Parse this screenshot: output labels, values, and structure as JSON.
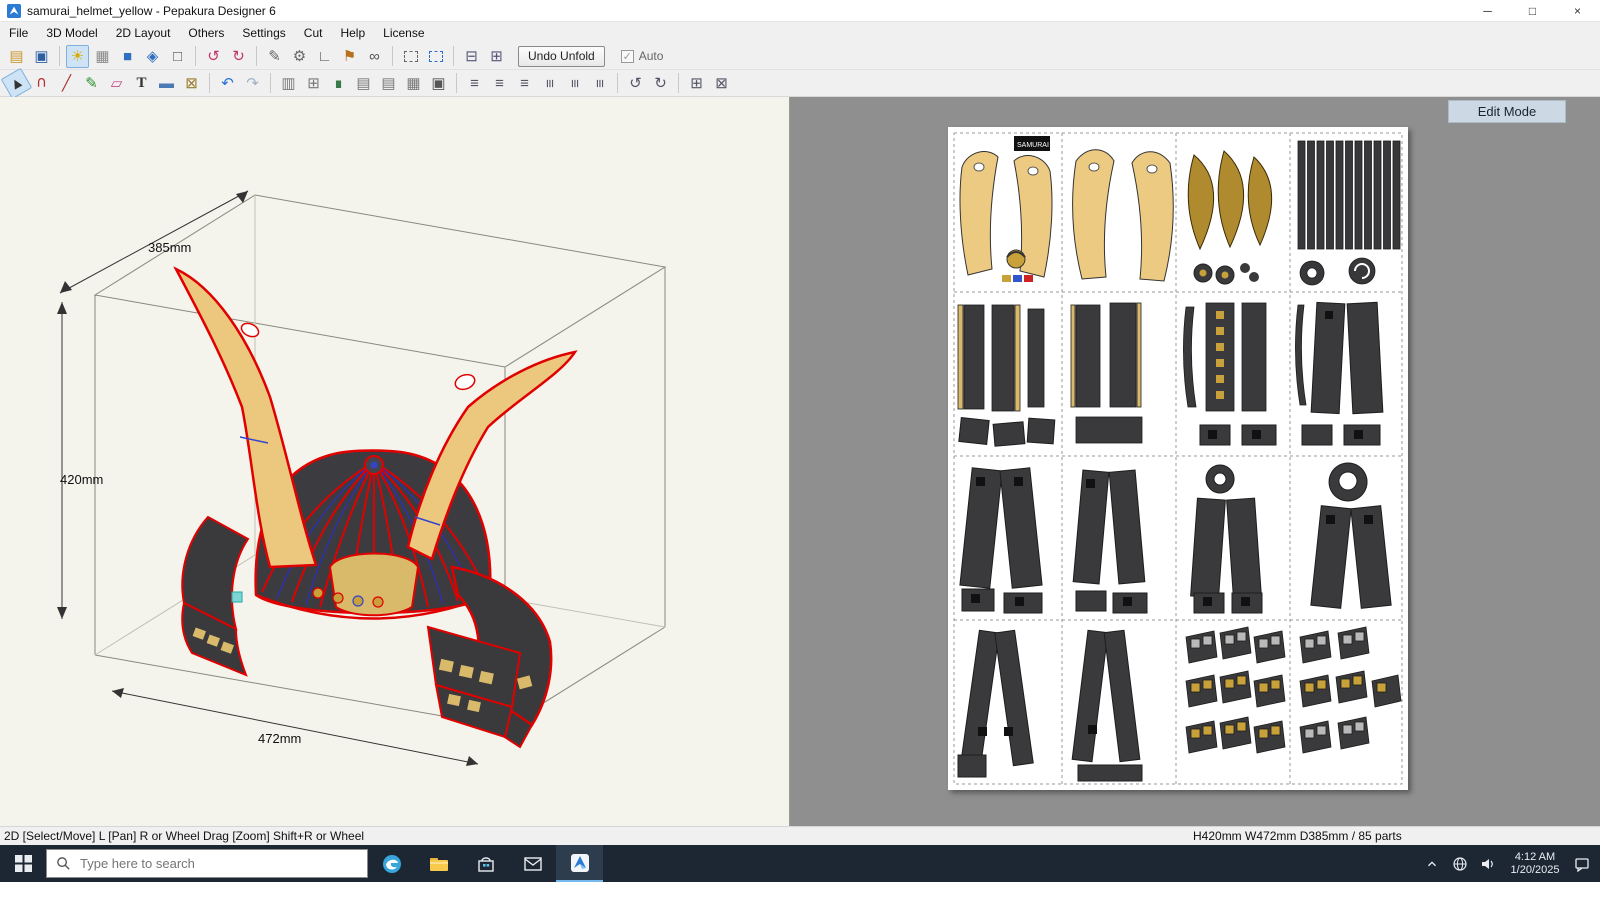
{
  "titlebar": {
    "title": "samurai_helmet_yellow - Pepakura Designer 6",
    "minimize": "─",
    "maximize": "□",
    "close": "×"
  },
  "menu": {
    "items": [
      "File",
      "3D Model",
      "2D Layout",
      "Others",
      "Settings",
      "Cut",
      "Help",
      "License"
    ]
  },
  "toolbar1": {
    "icons": [
      {
        "name": "open-folder-icon",
        "glyph": "▤"
      },
      {
        "name": "save-icon",
        "glyph": "▣"
      },
      {
        "name": "light-icon",
        "glyph": "☀"
      },
      {
        "name": "texture-icon",
        "glyph": "▦"
      },
      {
        "name": "shaded-view-icon",
        "glyph": "■"
      },
      {
        "name": "smooth-view-icon",
        "glyph": "◈"
      },
      {
        "name": "wireframe-view-icon",
        "glyph": "□"
      },
      {
        "name": "rotate-ccw-icon",
        "glyph": "↺"
      },
      {
        "name": "rotate-cw-icon",
        "glyph": "↻"
      },
      {
        "name": "edge-pen-icon",
        "glyph": "✎"
      },
      {
        "name": "gear-icon",
        "glyph": "⚙"
      },
      {
        "name": "protractor-icon",
        "glyph": "∟"
      },
      {
        "name": "flag-icon",
        "glyph": "⚑"
      },
      {
        "name": "link-icon",
        "glyph": "∞"
      },
      {
        "name": "select-area-icon",
        "glyph": ""
      },
      {
        "name": "select-area-plus-icon",
        "glyph": ""
      },
      {
        "name": "pane-split-h-icon",
        "glyph": "⊟"
      },
      {
        "name": "pane-split-v-icon",
        "glyph": "⊞"
      }
    ],
    "undo_unfold": "Undo Unfold",
    "auto_label": "Auto",
    "auto_check": "✓"
  },
  "toolbar2": {
    "icons": [
      {
        "name": "select-arrow-icon",
        "glyph": "▲"
      },
      {
        "name": "magnet-icon",
        "glyph": "∪"
      },
      {
        "name": "knife-icon",
        "glyph": "╱"
      },
      {
        "name": "pen-icon",
        "glyph": "✎"
      },
      {
        "name": "eraser-icon",
        "glyph": "▱"
      },
      {
        "name": "text-tool-icon",
        "glyph": "T"
      },
      {
        "name": "image-icon",
        "glyph": "▬"
      },
      {
        "name": "material-icon",
        "glyph": "⊠"
      },
      {
        "name": "undo-icon",
        "glyph": "↶"
      },
      {
        "name": "redo-icon",
        "glyph": "↷"
      },
      {
        "name": "book-icon",
        "glyph": "▥"
      },
      {
        "name": "flatten-icon",
        "glyph": "⊞"
      },
      {
        "name": "chart-icon",
        "glyph": "∎"
      },
      {
        "name": "export-doc-icon",
        "glyph": "▤"
      },
      {
        "name": "export-image-icon",
        "glyph": "▤"
      },
      {
        "name": "export-print-icon",
        "glyph": "▦"
      },
      {
        "name": "print-icon",
        "glyph": "▣"
      },
      {
        "name": "align-left-icon",
        "glyph": "≡"
      },
      {
        "name": "align-center-h-icon",
        "glyph": "≡"
      },
      {
        "name": "align-right-icon",
        "glyph": "≡"
      },
      {
        "name": "align-top-icon",
        "glyph": "≡"
      },
      {
        "name": "align-middle-icon",
        "glyph": "≡"
      },
      {
        "name": "align-bottom-icon",
        "glyph": "≡"
      },
      {
        "name": "rotate-left90-icon",
        "glyph": "↺"
      },
      {
        "name": "rotate-right90-icon",
        "glyph": "↻"
      },
      {
        "name": "arrange-parts-icon",
        "glyph": "⊞"
      },
      {
        "name": "interlock-icon",
        "glyph": "⊠"
      }
    ]
  },
  "view3d": {
    "dim_width": "385mm",
    "dim_height": "420mm",
    "dim_depth": "472mm"
  },
  "view2d": {
    "edit_mode": "Edit Mode",
    "sheet_logo": "SAMURAI"
  },
  "statusbar": {
    "left": "2D [Select/Move] L [Pan] R or Wheel Drag [Zoom] Shift+R or Wheel",
    "right": "H420mm W472mm D385mm / 85 parts"
  },
  "taskbar": {
    "search_placeholder": "Type here to search",
    "time": "4:12 AM",
    "date": "1/20/2025"
  },
  "colors": {
    "accent_red": "#e10000",
    "crest_tan": "#ecc87e",
    "part_dark": "#3a3a3c",
    "gold": "#c9a13b",
    "taskbar_bg": "#1d2733"
  }
}
